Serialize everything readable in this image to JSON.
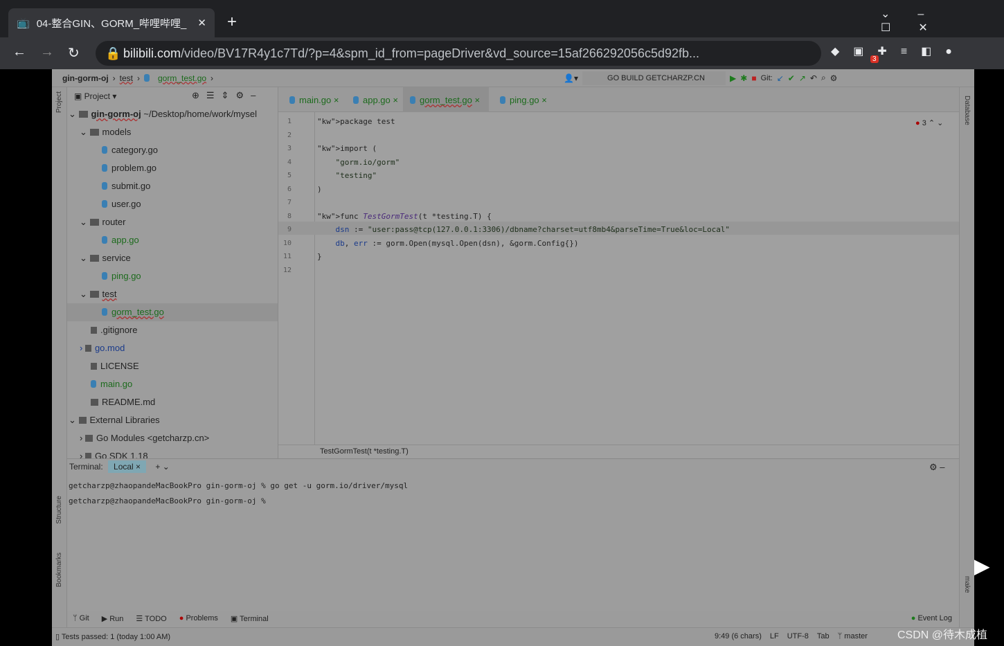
{
  "browser": {
    "tab_title": "04-整合GIN、GORM_哔哩哔哩_",
    "url_domain": "bilibili.com",
    "url_path": "/video/BV17R4y1c7Td/?p=4&spm_id_from=pageDriver&vd_source=15af266292056c5d92fb...",
    "ext_badge": "3"
  },
  "ide": {
    "breadcrumb": [
      "gin-gorm-oj",
      "test",
      "gorm_test.go"
    ],
    "run_config": "GO BUILD GETCHARZP.CN",
    "git_label": "Git:",
    "project_label": "Project",
    "tree": [
      {
        "label": "gin-gorm-oj",
        "suffix": "~/Desktop/home/work/mysel"
      },
      {
        "label": "models"
      },
      {
        "label": "category.go"
      },
      {
        "label": "problem.go"
      },
      {
        "label": "submit.go"
      },
      {
        "label": "user.go"
      },
      {
        "label": "router"
      },
      {
        "label": "app.go"
      },
      {
        "label": "service"
      },
      {
        "label": "ping.go"
      },
      {
        "label": "test"
      },
      {
        "label": "gorm_test.go"
      },
      {
        "label": ".gitignore"
      },
      {
        "label": "go.mod"
      },
      {
        "label": "LICENSE"
      },
      {
        "label": "main.go"
      },
      {
        "label": "README.md"
      },
      {
        "label": "External Libraries"
      },
      {
        "label": "Go Modules <getcharzp.cn>"
      },
      {
        "label": "Go SDK 1.18"
      }
    ],
    "tabs": [
      "main.go",
      "app.go",
      "gorm_test.go",
      "ping.go"
    ],
    "error_count": "3",
    "code": [
      "package test",
      "",
      "import (",
      "    \"gorm.io/gorm\"",
      "    \"testing\"",
      ")",
      "",
      "func TestGormTest(t *testing.T) {",
      "    dsn := \"user:pass@tcp(127.0.0.1:3306)/dbname?charset=utf8mb4&parseTime=True&loc=Local\"",
      "    db, err := gorm.Open(mysql.Open(dsn), &gorm.Config{})",
      "}",
      ""
    ],
    "editor_breadcrumb": "TestGormTest(t *testing.T)",
    "terminal": {
      "label": "Terminal:",
      "tab": "Local",
      "lines": [
        "getcharzp@zhaopandeMacBookPro gin-gorm-oj % go get -u gorm.io/driver/mysql",
        "getcharzp@zhaopandeMacBookPro gin-gorm-oj %"
      ]
    },
    "toolwindows": [
      "Git",
      "Run",
      "TODO",
      "Problems",
      "Terminal"
    ],
    "event_log": "Event Log",
    "side_labels": [
      "Project",
      "Structure",
      "Bookmarks",
      "Database",
      "make"
    ],
    "status": {
      "message": "Tests passed: 1 (today 1:00 AM)",
      "position": "9:49 (6 chars)",
      "line_sep": "LF",
      "encoding": "UTF-8",
      "indent": "Tab",
      "branch": "master"
    }
  },
  "watermark": "CSDN @待木成植"
}
